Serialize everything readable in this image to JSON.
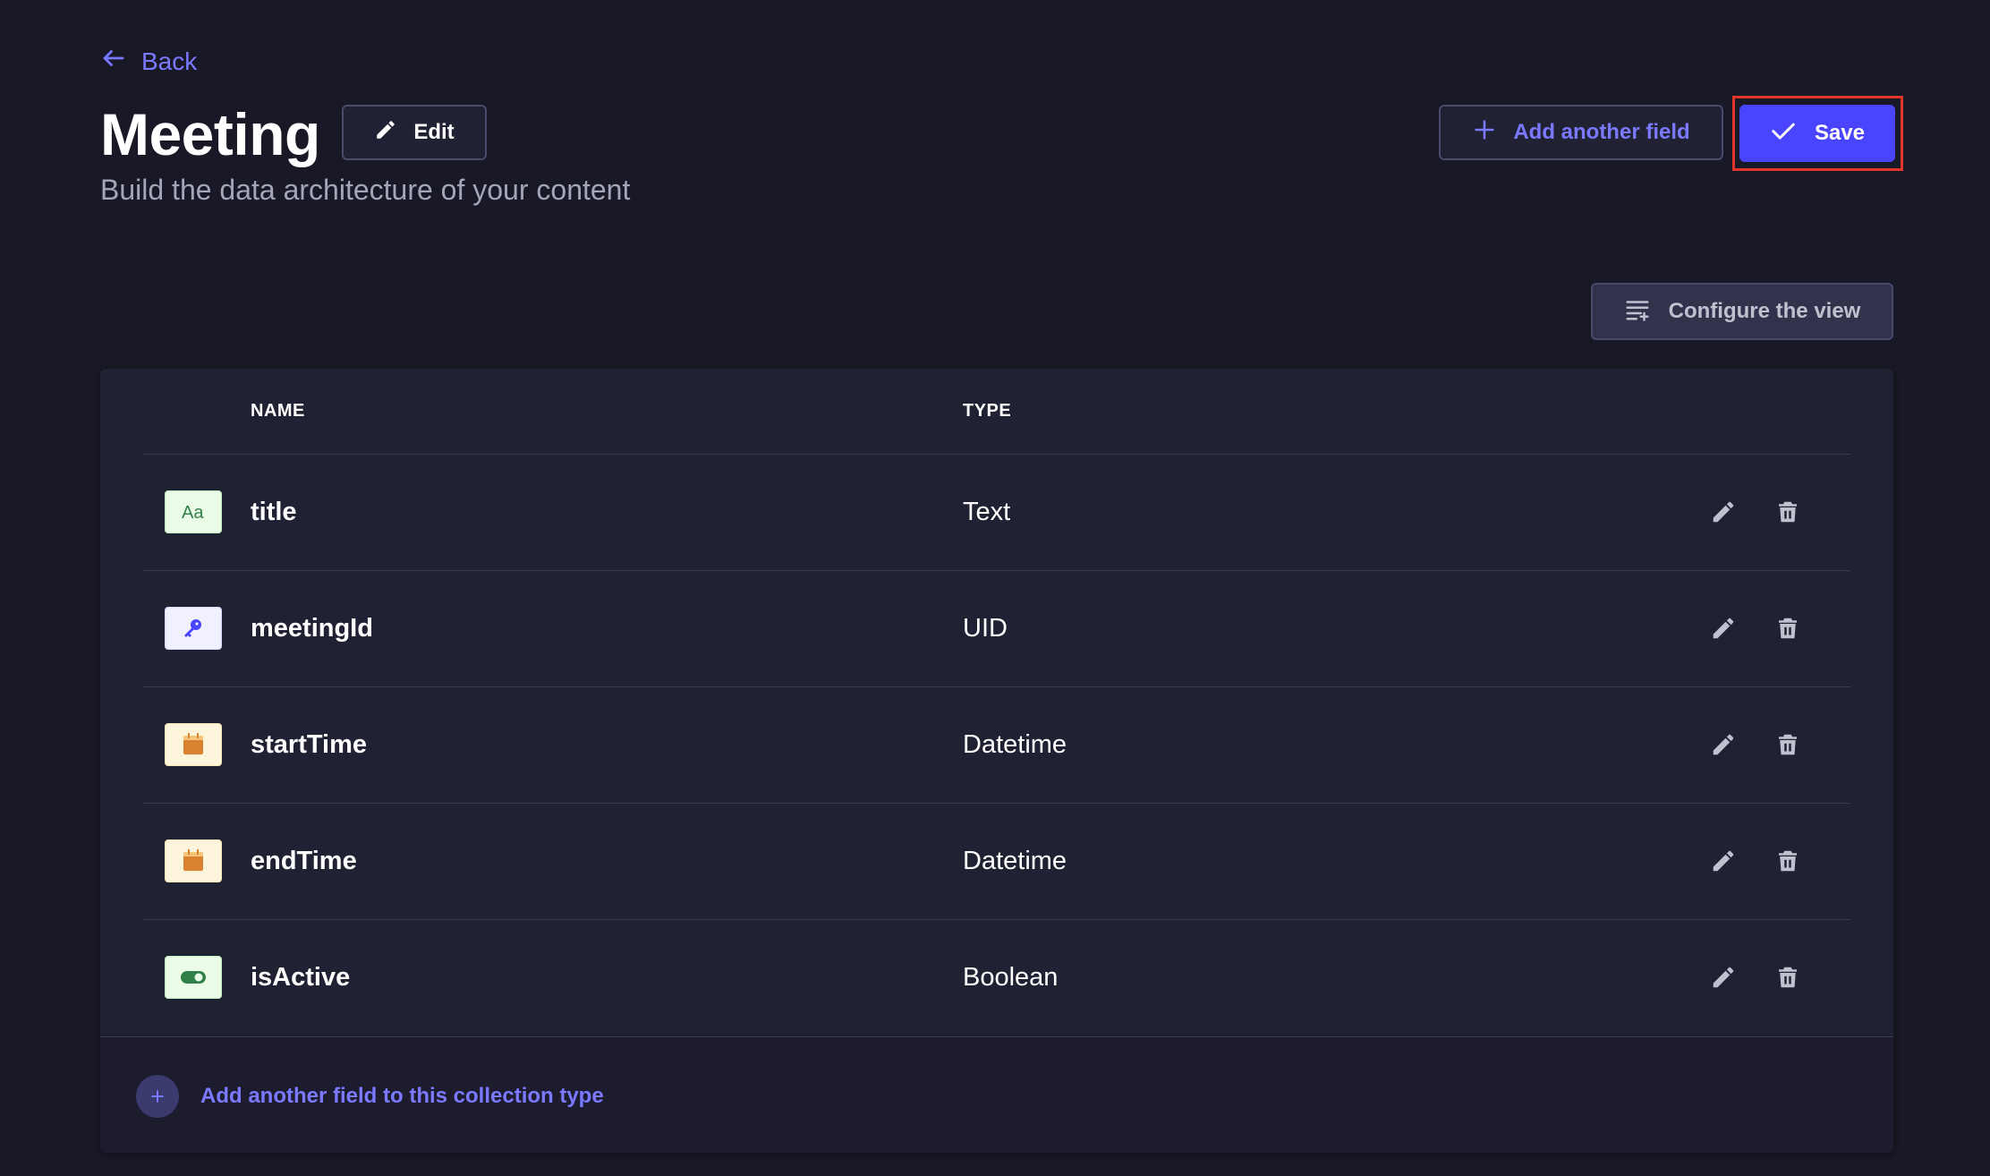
{
  "header": {
    "back_label": "Back",
    "title": "Meeting",
    "edit_label": "Edit",
    "subtitle": "Build the data architecture of your content",
    "add_field_label": "Add another field",
    "save_label": "Save",
    "configure_label": "Configure the view"
  },
  "table": {
    "columns": {
      "name": "NAME",
      "type": "TYPE"
    },
    "rows": [
      {
        "name": "title",
        "type": "Text",
        "icon": "text-field-icon"
      },
      {
        "name": "meetingId",
        "type": "UID",
        "icon": "key-icon"
      },
      {
        "name": "startTime",
        "type": "Datetime",
        "icon": "calendar-icon"
      },
      {
        "name": "endTime",
        "type": "Datetime",
        "icon": "calendar-icon"
      },
      {
        "name": "isActive",
        "type": "Boolean",
        "icon": "toggle-icon"
      }
    ],
    "footer_add_label": "Add another field to this collection type"
  },
  "colors": {
    "background": "#181826",
    "card": "#212134",
    "accent": "#7b79ff",
    "primary_button": "#4945ff",
    "highlight_outline": "#e23428"
  }
}
